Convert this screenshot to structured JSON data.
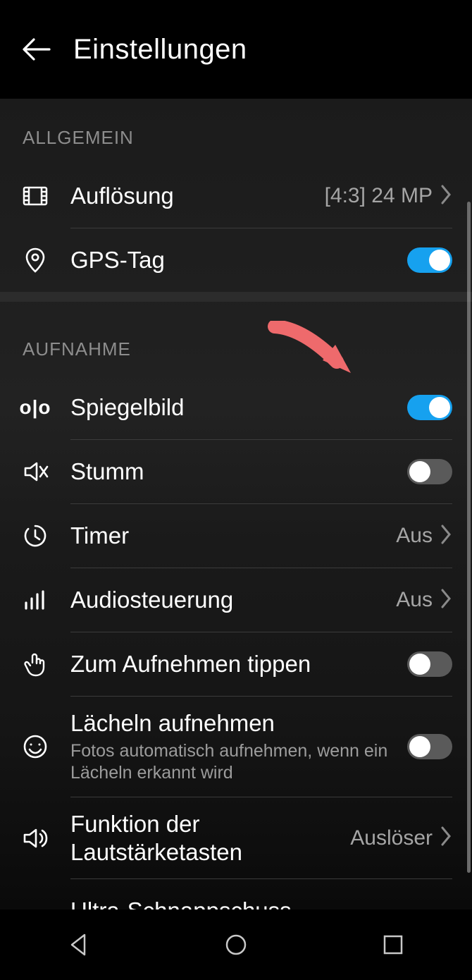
{
  "header": {
    "title": "Einstellungen"
  },
  "sections": {
    "general": {
      "title": "ALLGEMEIN",
      "resolution": {
        "label": "Auflösung",
        "value": "[4:3] 24 MP"
      },
      "gps": {
        "label": "GPS-Tag",
        "on": true
      }
    },
    "capture": {
      "title": "AUFNAHME",
      "mirror": {
        "label": "Spiegelbild",
        "on": true
      },
      "mute": {
        "label": "Stumm",
        "on": false
      },
      "timer": {
        "label": "Timer",
        "value": "Aus"
      },
      "audio": {
        "label": "Audiosteuerung",
        "value": "Aus"
      },
      "tap": {
        "label": "Zum Aufnehmen tippen",
        "on": false
      },
      "smile": {
        "label": "Lächeln aufnehmen",
        "sub": "Fotos automatisch aufnehmen, wenn ein Lächeln erkannt wird",
        "on": false
      },
      "volkey": {
        "label": "Funktion der Lautstärketasten",
        "value": "Auslöser"
      },
      "ultra": {
        "label": "Ultra-Schnappschuss"
      }
    }
  }
}
